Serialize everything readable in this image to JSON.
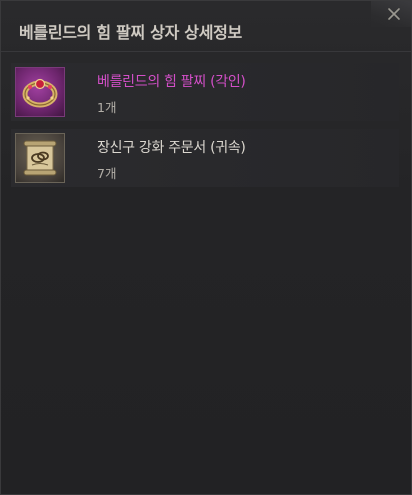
{
  "window": {
    "title": "베를린드의 힘 팔찌 상자 상세정보"
  },
  "items": [
    {
      "name": "베를린드의 힘 팔찌 (각인)",
      "quantity": "1개",
      "icon": "bracelet-icon",
      "name_color": "#d34fc8"
    },
    {
      "name": "장신구 강화 주문서 (귀속)",
      "quantity": "7개",
      "icon": "enhancement-scroll-icon",
      "name_color": "#dcd8d0"
    }
  ]
}
